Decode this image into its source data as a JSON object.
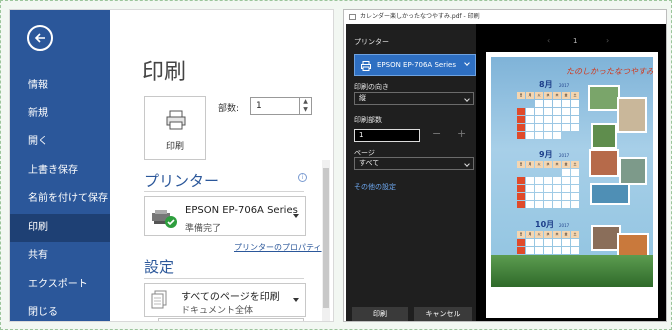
{
  "left": {
    "nav_items": [
      "情報",
      "新規",
      "開く",
      "上書き保存",
      "名前を付けて保存",
      "印刷",
      "共有",
      "エクスポート",
      "閉じる"
    ],
    "active_nav": "印刷",
    "title": "印刷",
    "print_button_label": "印刷",
    "copies_label": "部数:",
    "copies_value": "1",
    "printer_section": "プリンター",
    "printer_name": "EPSON EP-706A Series",
    "printer_status": "準備完了",
    "printer_properties_link": "プリンターのプロパティ",
    "settings_section": "設定",
    "setting_main": "すべてのページを印刷",
    "setting_sub": "ドキュメント全体"
  },
  "right": {
    "dialog_title": "カレンダー楽しかったなつやすみ.pdf - 印刷",
    "printer_label": "プリンター",
    "printer_value": "EPSON EP-706A Series",
    "orientation_label": "印刷の向き",
    "orientation_value": "縦",
    "copies_label": "印刷部数",
    "copies_value": "1",
    "pages_label": "ページ",
    "pages_value": "すべて",
    "more_settings": "その他の設定",
    "print_button": "印刷",
    "cancel_button": "キャンセル",
    "page_number": "1"
  },
  "calendar": {
    "title": "たのしかったなつやすみ",
    "months": [
      "8月",
      "9月",
      "10月"
    ],
    "year": "2017",
    "weekdays": [
      "日",
      "月",
      "火",
      "水",
      "木",
      "金",
      "土"
    ]
  }
}
